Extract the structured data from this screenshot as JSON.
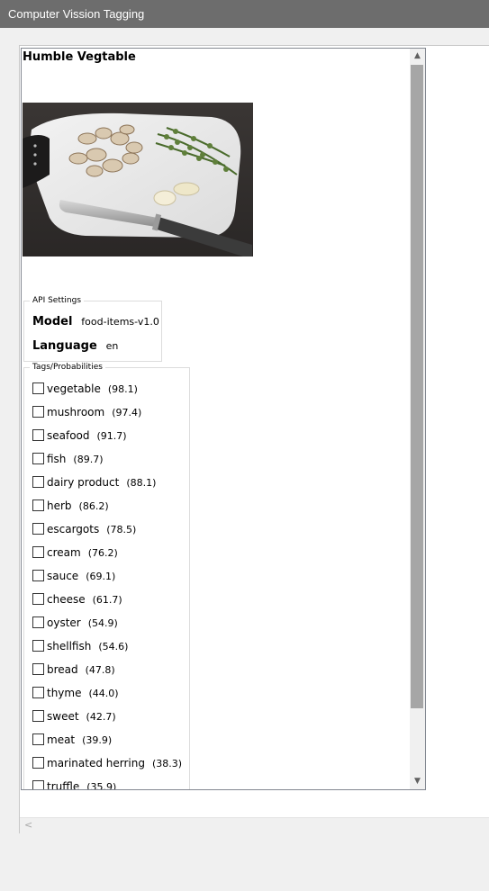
{
  "window": {
    "title": "Computer Vission Tagging"
  },
  "result": {
    "heading": "Humble Vegtable"
  },
  "image": {
    "alt": "cutting board with mushrooms, thyme, garlic and knife"
  },
  "api_settings": {
    "group_label": "API Settings",
    "model_label": "Model",
    "model_value": "food-items-v1.0",
    "language_label": "Language",
    "language_value": "en"
  },
  "tags": {
    "group_label": "Tags/Probabilities",
    "items": [
      {
        "name": "vegetable",
        "prob": "(98.1)"
      },
      {
        "name": "mushroom",
        "prob": "(97.4)"
      },
      {
        "name": "seafood",
        "prob": "(91.7)"
      },
      {
        "name": "fish",
        "prob": "(89.7)"
      },
      {
        "name": "dairy product",
        "prob": "(88.1)"
      },
      {
        "name": "herb",
        "prob": "(86.2)"
      },
      {
        "name": "escargots",
        "prob": "(78.5)"
      },
      {
        "name": "cream",
        "prob": "(76.2)"
      },
      {
        "name": "sauce",
        "prob": "(69.1)"
      },
      {
        "name": "cheese",
        "prob": "(61.7)"
      },
      {
        "name": "oyster",
        "prob": "(54.9)"
      },
      {
        "name": "shellfish",
        "prob": "(54.6)"
      },
      {
        "name": "bread",
        "prob": "(47.8)"
      },
      {
        "name": "thyme",
        "prob": "(44.0)"
      },
      {
        "name": "sweet",
        "prob": "(42.7)"
      },
      {
        "name": "meat",
        "prob": "(39.9)"
      },
      {
        "name": "marinated herring",
        "prob": "(38.3)"
      },
      {
        "name": "truffle",
        "prob": "(35.9)"
      }
    ]
  },
  "colors": {
    "titlebar": "#6d6d6d",
    "scroll_thumb": "#a6a6a6",
    "window_bg": "#f0f0f0"
  }
}
